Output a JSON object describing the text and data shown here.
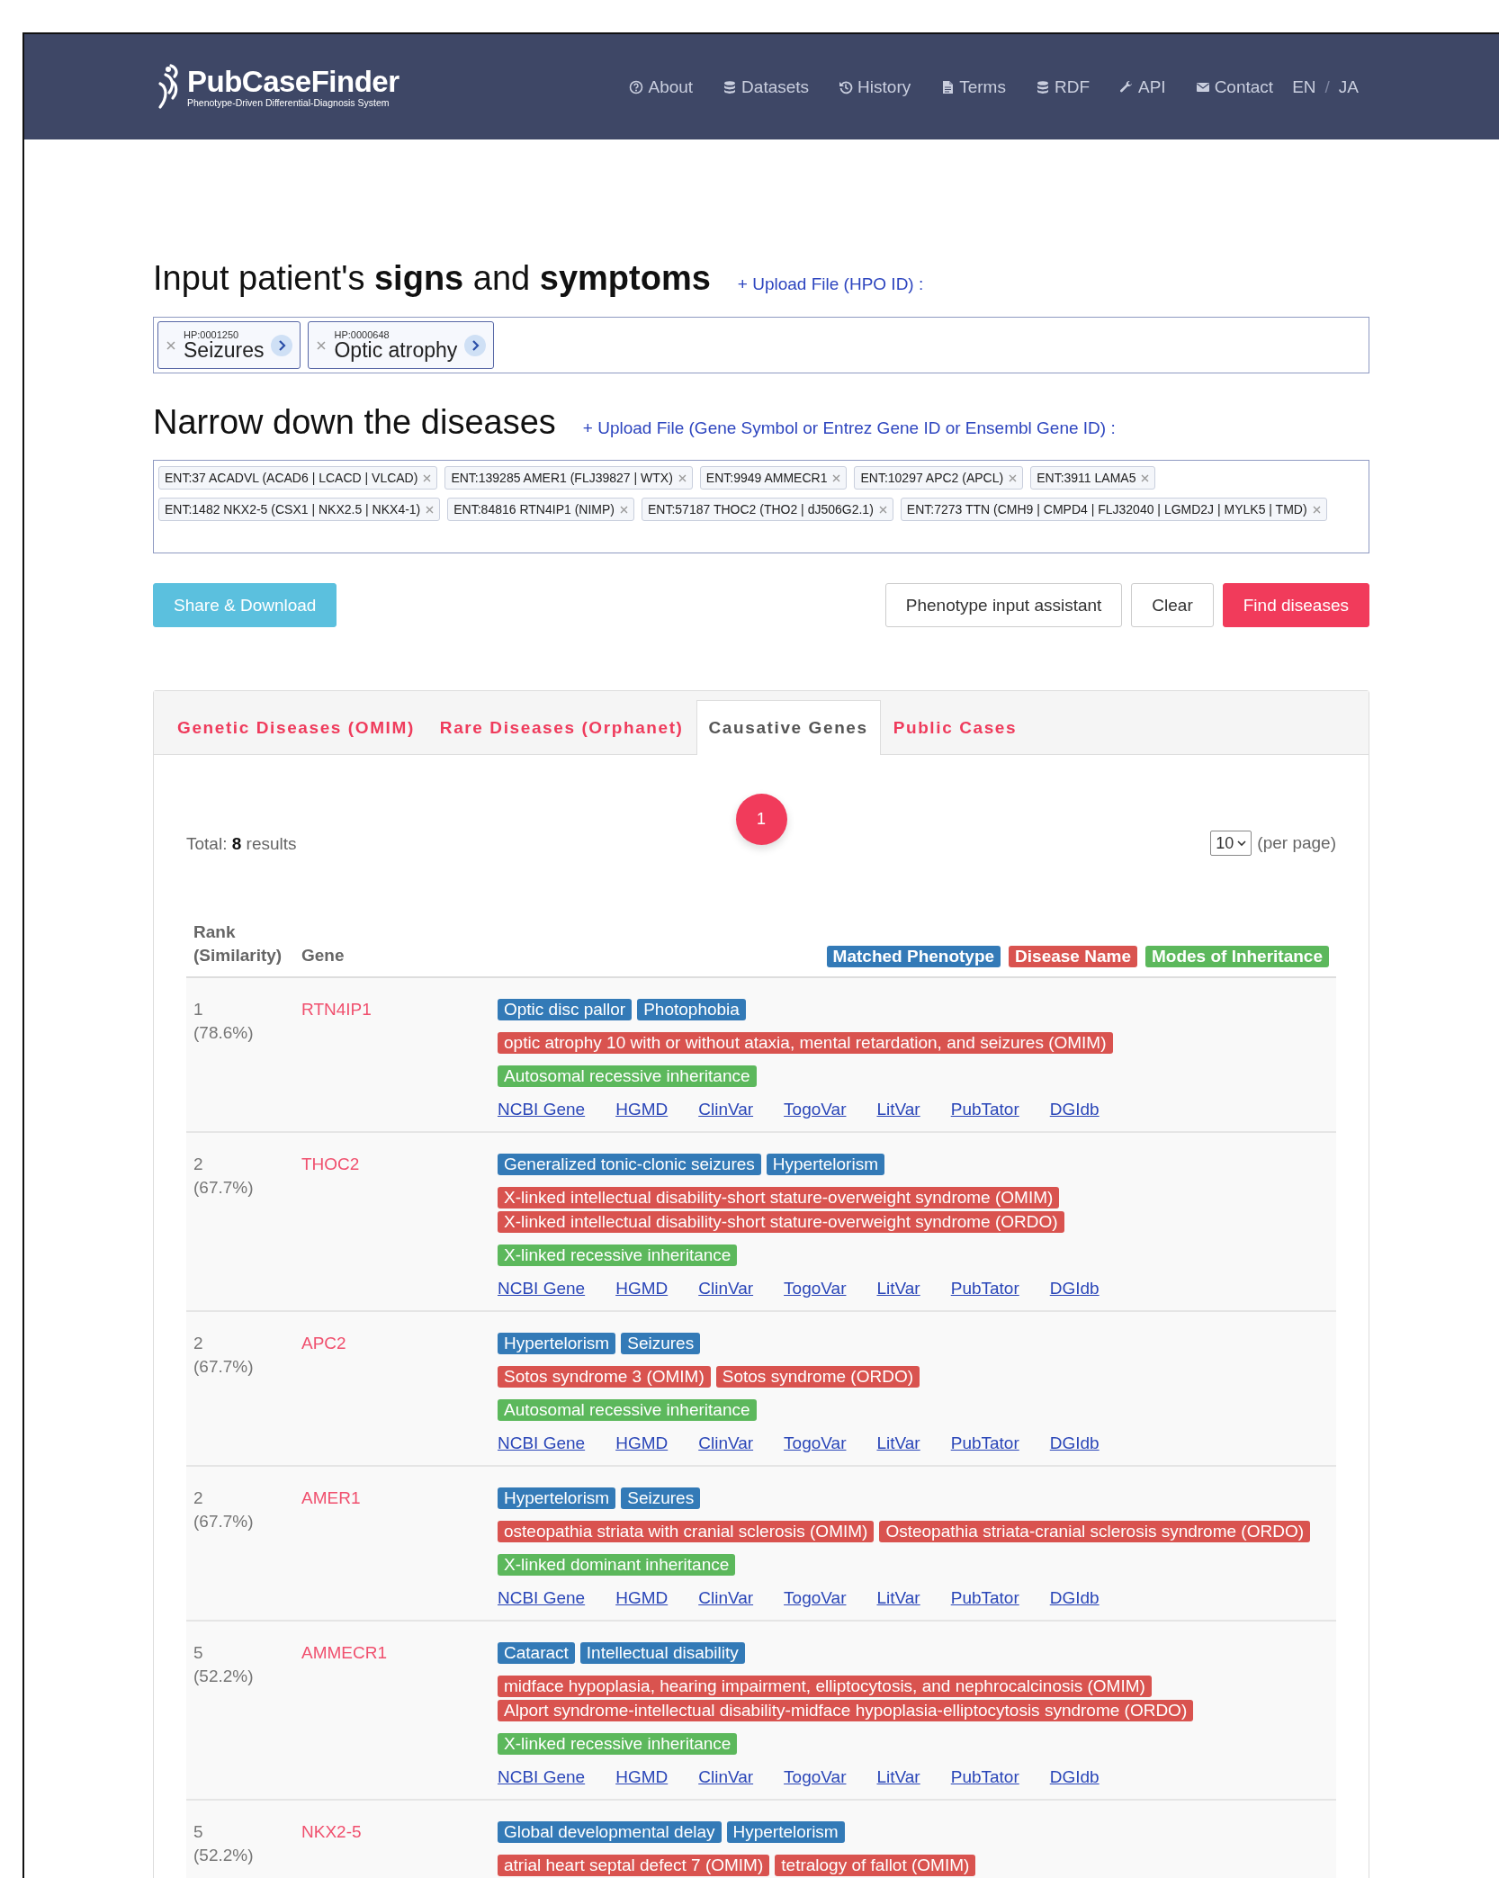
{
  "header": {
    "logo": {
      "title": "PubCaseFinder",
      "subtitle": "Phenotype-Driven Differential-Diagnosis System"
    },
    "nav": [
      "About",
      "Datasets",
      "History",
      "Terms",
      "RDF",
      "API",
      "Contact"
    ],
    "languages": [
      "EN",
      "JA"
    ],
    "language_separator": "/"
  },
  "symptoms": {
    "title": "Input patient's **signs** and **symptoms**",
    "upload_link": "+ Upload File (HPO ID) :",
    "terms": [
      {
        "id": "HP:0001250",
        "label": "Seizures"
      },
      {
        "id": "HP:0000648",
        "label": "Optic atrophy"
      }
    ]
  },
  "genes": {
    "title": "Narrow down the diseases",
    "upload_link": "+ Upload File (Gene Symbol or Entrez Gene ID or Ensembl Gene ID) :",
    "chips": [
      "ENT:37 ACADVL (ACAD6 | LCACD | VLCAD)",
      "ENT:139285 AMER1 (FLJ39827 | WTX)",
      "ENT:9949 AMMECR1",
      "ENT:10297 APC2 (APCL)",
      "ENT:3911 LAMA5",
      "ENT:1482 NKX2-5 (CSX1 | NKX2.5 | NKX4-1)",
      "ENT:84816 RTN4IP1 (NIMP)",
      "ENT:57187 THOC2 (THO2 | dJ506G2.1)",
      "ENT:7273 TTN (CMH9 | CMPD4 | FLJ32040 | LGMD2J | MYLK5 | TMD)"
    ]
  },
  "actions": [
    {
      "label": "Share & Download",
      "kind": "info"
    },
    {
      "label": "Phenotype input assistant",
      "kind": "default"
    },
    {
      "label": "Clear",
      "kind": "default"
    },
    {
      "label": "Find diseases",
      "kind": "primary"
    }
  ],
  "tabs": [
    {
      "label": "Genetic Diseases (OMIM)",
      "selected": false
    },
    {
      "label": "Rare Diseases (Orphanet)",
      "selected": false
    },
    {
      "label": "Causative Genes",
      "selected": true
    },
    {
      "label": "Public Cases",
      "selected": false
    }
  ],
  "results": {
    "total": "Total: **8** results",
    "pages": [
      {
        "label": "1",
        "selected": true
      }
    ],
    "per_page": {
      "value": "10",
      "label": "(per page)"
    },
    "columns": [
      "Rank (Similarity)",
      "Gene"
    ],
    "legend": [
      {
        "label": "Matched Phenotype",
        "kind": "phenotype"
      },
      {
        "label": "Disease Name",
        "kind": "disease"
      },
      {
        "label": "Modes of Inheritance",
        "kind": "inheritance"
      }
    ],
    "rows": [
      {
        "rank": "1",
        "similarity": "(78.6%)",
        "gene": "RTN4IP1",
        "phenotypes": [
          "Optic disc pallor",
          "Photophobia"
        ],
        "diseases": [
          "optic atrophy 10 with or without ataxia, mental retardation, and seizures (OMIM)"
        ],
        "inheritance": [
          "Autosomal recessive inheritance"
        ],
        "links": [
          "NCBI Gene",
          "HGMD",
          "ClinVar",
          "TogoVar",
          "LitVar",
          "PubTator",
          "DGIdb"
        ]
      },
      {
        "rank": "2",
        "similarity": "(67.7%)",
        "gene": "THOC2",
        "phenotypes": [
          "Generalized tonic-clonic seizures",
          "Hypertelorism"
        ],
        "diseases": [
          "X-linked intellectual disability-short stature-overweight syndrome (OMIM)",
          "X-linked intellectual disability-short stature-overweight syndrome (ORDO)"
        ],
        "inheritance": [
          "X-linked recessive inheritance"
        ],
        "links": [
          "NCBI Gene",
          "HGMD",
          "ClinVar",
          "TogoVar",
          "LitVar",
          "PubTator",
          "DGIdb"
        ]
      },
      {
        "rank": "2",
        "similarity": "(67.7%)",
        "gene": "APC2",
        "phenotypes": [
          "Hypertelorism",
          "Seizures"
        ],
        "diseases": [
          "Sotos syndrome 3 (OMIM)",
          "Sotos syndrome (ORDO)"
        ],
        "inheritance": [
          "Autosomal recessive inheritance"
        ],
        "links": [
          "NCBI Gene",
          "HGMD",
          "ClinVar",
          "TogoVar",
          "LitVar",
          "PubTator",
          "DGIdb"
        ]
      },
      {
        "rank": "2",
        "similarity": "(67.7%)",
        "gene": "AMER1",
        "phenotypes": [
          "Hypertelorism",
          "Seizures"
        ],
        "diseases": [
          "osteopathia striata with cranial sclerosis (OMIM)",
          "Osteopathia striata-cranial sclerosis syndrome (ORDO)"
        ],
        "inheritance": [
          "X-linked dominant inheritance"
        ],
        "links": [
          "NCBI Gene",
          "HGMD",
          "ClinVar",
          "TogoVar",
          "LitVar",
          "PubTator",
          "DGIdb"
        ]
      },
      {
        "rank": "5",
        "similarity": "(52.2%)",
        "gene": "AMMECR1",
        "phenotypes": [
          "Cataract",
          "Intellectual disability"
        ],
        "diseases": [
          "midface hypoplasia, hearing impairment, elliptocytosis, and nephrocalcinosis (OMIM)",
          "Alport syndrome-intellectual disability-midface hypoplasia-elliptocytosis syndrome (ORDO)"
        ],
        "inheritance": [
          "X-linked recessive inheritance"
        ],
        "links": [
          "NCBI Gene",
          "HGMD",
          "ClinVar",
          "TogoVar",
          "LitVar",
          "PubTator",
          "DGIdb"
        ]
      },
      {
        "rank": "5",
        "similarity": "(52.2%)",
        "gene": "NKX2-5",
        "phenotypes": [
          "Global developmental delay",
          "Hypertelorism"
        ],
        "diseases": [
          "atrial heart septal defect 7 (OMIM)",
          "tetralogy of fallot (OMIM)"
        ]
      }
    ]
  }
}
